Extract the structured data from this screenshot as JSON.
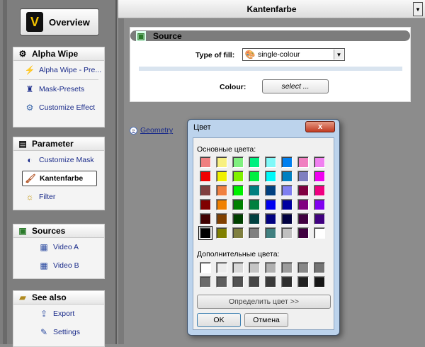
{
  "sidebar": {
    "overview_label": "Overview",
    "overview_logo": "V",
    "alpha_wipe": {
      "title": "Alpha Wipe",
      "items": [
        "Alpha Wipe - Pre...",
        "Mask-Presets",
        "Customize Effect"
      ]
    },
    "parameter": {
      "title": "Parameter",
      "items": [
        "Customize Mask",
        "Kantenfarbe",
        "Filter"
      ],
      "active": "Kantenfarbe"
    },
    "sources": {
      "title": "Sources",
      "items": [
        "Video A",
        "Video B"
      ]
    },
    "see_also": {
      "title": "See also",
      "items": [
        "Export",
        "Settings"
      ]
    }
  },
  "main": {
    "title": "Kantenfarbe",
    "source_section": {
      "title": "Source",
      "type_of_fill_label": "Type of fill:",
      "type_of_fill_value": "single-colour",
      "colour_label": "Colour:",
      "select_button": "select ..."
    },
    "geometry_link": "Geometry"
  },
  "color_dialog": {
    "title": "Цвет",
    "close_glyph": "x",
    "basic_colors_label": "Основные цвета:",
    "basic_colors": [
      "#f08080",
      "#f8f080",
      "#80f080",
      "#00f080",
      "#80f8f8",
      "#0080f0",
      "#f080c0",
      "#f080f0",
      "#f00000",
      "#f0f000",
      "#80f000",
      "#00f040",
      "#00f8f8",
      "#0080c0",
      "#8080c0",
      "#f000f0",
      "#804040",
      "#f08040",
      "#00f000",
      "#008080",
      "#004080",
      "#8080f0",
      "#800040",
      "#f00080",
      "#800000",
      "#f08000",
      "#008000",
      "#008040",
      "#0000f0",
      "#0000a0",
      "#800080",
      "#8000f0",
      "#400000",
      "#804000",
      "#004000",
      "#004040",
      "#000080",
      "#000040",
      "#400040",
      "#400080",
      "#000000",
      "#808000",
      "#808040",
      "#808080",
      "#408080",
      "#c0c0c0",
      "#400040",
      "#ffffff"
    ],
    "selected_basic_index": 40,
    "custom_colors_label": "Дополнительные цвета:",
    "custom_colors": [
      "#ffffff",
      "#ececec",
      "#d8d8d8",
      "#c4c4c4",
      "#b0b0b0",
      "#9c9c9c",
      "#888888",
      "#747474",
      "#6a6a6a",
      "#5e5e5e",
      "#525252",
      "#464646",
      "#3a3a3a",
      "#2e2e2e",
      "#222222",
      "#161616"
    ],
    "define_button": "Определить цвет >>",
    "ok_button": "OK",
    "cancel_button": "Отмена"
  }
}
